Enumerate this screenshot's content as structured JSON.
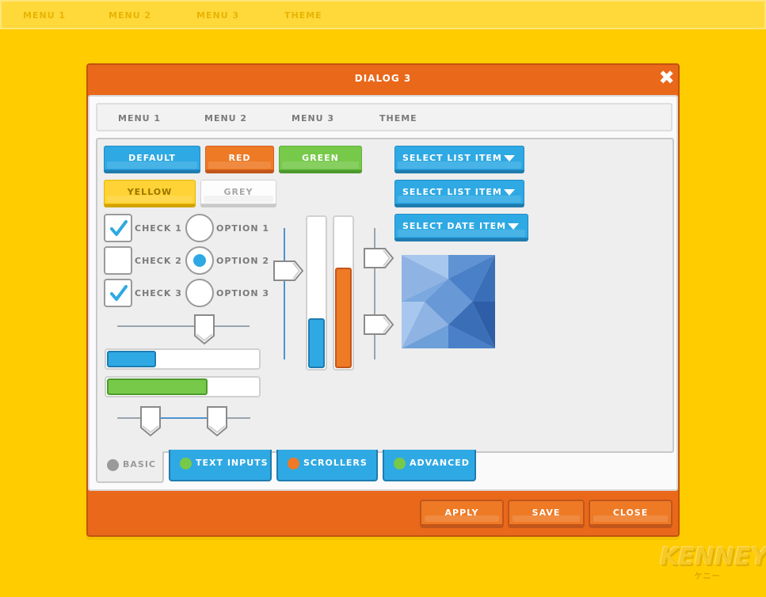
{
  "topbar": {
    "menu1": "MENU 1",
    "menu2": "MENU 2",
    "menu3": "MENU 3",
    "theme": "THEME"
  },
  "dialog": {
    "title": "DIALOG 3",
    "close_icon": "✖",
    "menubar": {
      "menu1": "MENU 1",
      "menu2": "MENU 2",
      "menu3": "MENU 3",
      "theme": "THEME"
    },
    "buttons": {
      "default": "DEFAULT",
      "red": "RED",
      "green": "GREEN",
      "yellow": "YELLOW",
      "grey": "GREY"
    },
    "selects": [
      "SELECT LIST ITEM",
      "SELECT LIST ITEM",
      "SELECT DATE ITEM"
    ],
    "checks": [
      {
        "label": "CHECK 1",
        "checked": true
      },
      {
        "label": "CHECK 2",
        "checked": false
      },
      {
        "label": "CHECK 3",
        "checked": true
      }
    ],
    "options": [
      {
        "label": "OPTION 1",
        "selected": false
      },
      {
        "label": "OPTION 2",
        "selected": true
      },
      {
        "label": "OPTION 3",
        "selected": false
      }
    ],
    "progress_blue": 0.32,
    "progress_green": 0.66,
    "vbar_blue": 0.33,
    "vbar_orange": 0.66,
    "tabs": {
      "basic": "BASIC",
      "text_inputs": "TEXT INPUTS",
      "scrollers": "SCROLLERS",
      "advanced": "ADVANCED"
    },
    "footer": {
      "apply": "APPLY",
      "save": "SAVE",
      "close": "CLOSE"
    }
  },
  "logo": {
    "name": "KENNEY",
    "sub": "ケニー"
  },
  "colors": {
    "background": "#ffcc00",
    "accent": "#e9681a",
    "blue": "#2fa9e3",
    "green": "#77c94a",
    "grey": "#9a9a9a"
  }
}
